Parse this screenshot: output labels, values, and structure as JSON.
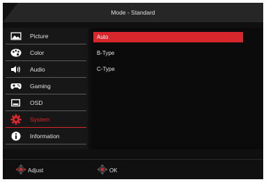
{
  "header": {
    "title": "Mode - Standard"
  },
  "sidebar": {
    "items": [
      {
        "label": "Picture",
        "icon": "picture-icon"
      },
      {
        "label": "Color",
        "icon": "color-palette-icon"
      },
      {
        "label": "Audio",
        "icon": "speaker-icon"
      },
      {
        "label": "Gaming",
        "icon": "gamepad-icon"
      },
      {
        "label": "OSD",
        "icon": "osd-icon"
      },
      {
        "label": "System",
        "icon": "gear-icon",
        "active": true
      },
      {
        "label": "Information",
        "icon": "info-icon"
      }
    ]
  },
  "options": [
    {
      "label": "Auto",
      "selected": true
    },
    {
      "label": "B-Type"
    },
    {
      "label": "C-Type"
    }
  ],
  "footer": {
    "adjust_label": "Adjust",
    "ok_label": "OK"
  },
  "colors": {
    "accent": "#d8262d",
    "background": "#0f0f0f",
    "header": "#262626"
  }
}
